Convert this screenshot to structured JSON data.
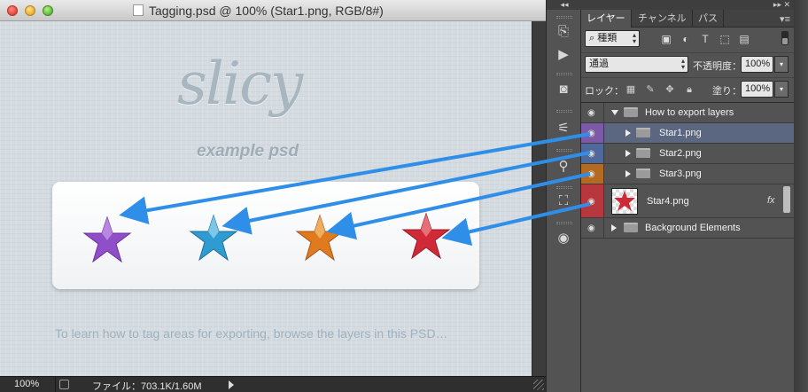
{
  "document": {
    "title": "Tagging.psd @ 100% (Star1.png, RGB/8#)",
    "logo_text": "slicy",
    "logo_subtitle": "example psd",
    "hint_text": "To learn how to tag areas for exporting, browse the layers in this PSD…",
    "star_colors": [
      "#8f4fc8",
      "#2f9bd0",
      "#e07a1e",
      "#d02a38"
    ]
  },
  "statusbar": {
    "zoom": "100%",
    "file_info": "ファイル：703.1K/1.60M"
  },
  "panel": {
    "tabs": [
      "レイヤー",
      "チャンネル",
      "パス"
    ],
    "filter_label": "種類",
    "blend_mode": "通過",
    "opacity_label": "不透明度：",
    "opacity_value": "100%",
    "lock_label": "ロック：",
    "fill_label": "塗り：",
    "fill_value": "100%"
  },
  "layers": [
    {
      "name": "How to export layers",
      "type": "group",
      "expanded": true,
      "color": "#535353"
    },
    {
      "name": "Star1.png",
      "type": "group",
      "color": "#7d5aa8",
      "selected": true
    },
    {
      "name": "Star2.png",
      "type": "group",
      "color": "#4f6a9a"
    },
    {
      "name": "Star3.png",
      "type": "group",
      "color": "#b46a20"
    },
    {
      "name": "Star4.png",
      "type": "smart-object",
      "color": "#b8363d",
      "fx": "fx"
    },
    {
      "name": "Background Elements",
      "type": "group",
      "color": "#535353"
    }
  ],
  "colors": {
    "arrow": "#2f8fe8",
    "selected_row": "#5a6a8a"
  }
}
